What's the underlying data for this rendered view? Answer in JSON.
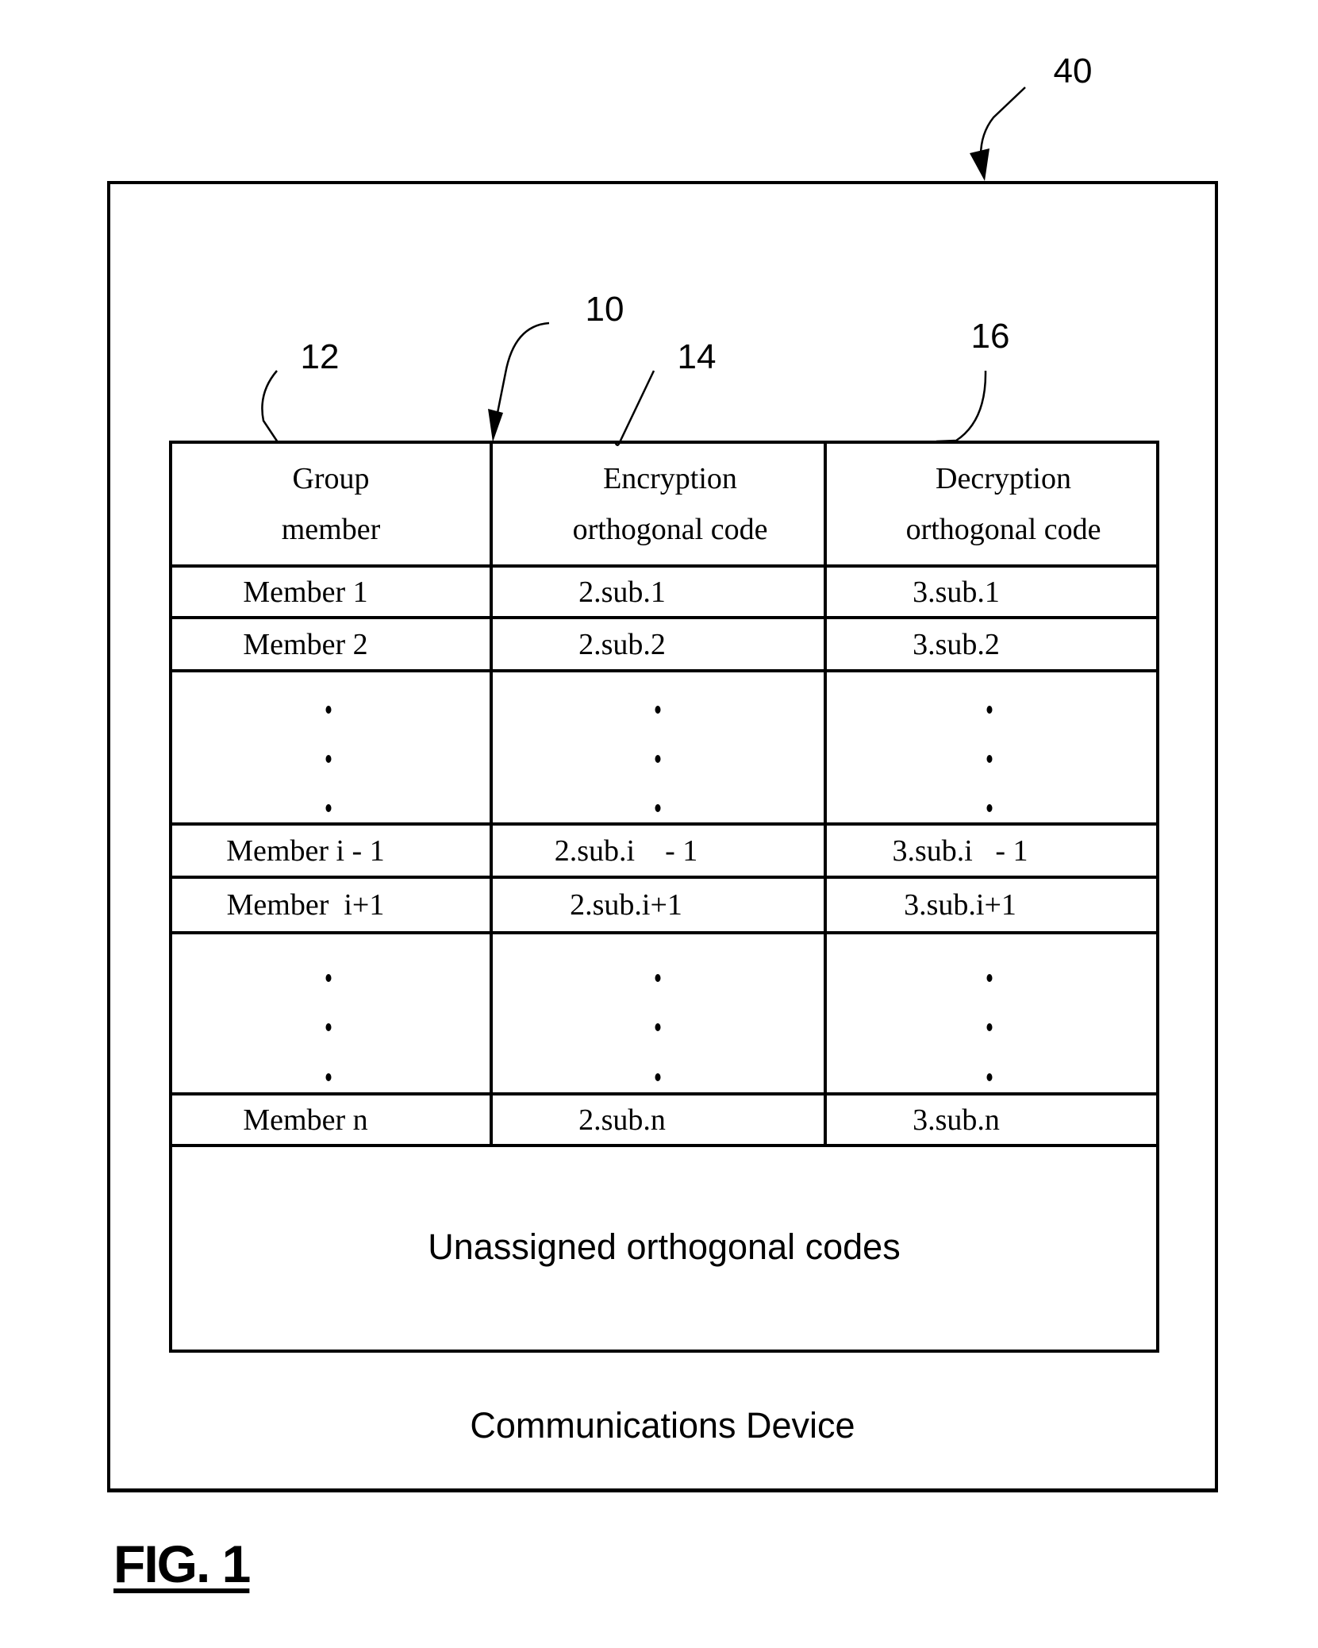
{
  "figure": {
    "label": "FIG. 1",
    "device_label": "Communications Device",
    "unassigned_label": "Unassigned orthogonal codes"
  },
  "reference_numerals": {
    "device": "40",
    "table": "10",
    "member_column": "12",
    "encryption_column": "14",
    "decryption_column": "16"
  },
  "table": {
    "headers": [
      {
        "line1": "Group",
        "line2": "member"
      },
      {
        "line1": "Encryption",
        "line2": "orthogonal code"
      },
      {
        "line1": "Decryption",
        "line2": "orthogonal code"
      }
    ],
    "rows": [
      {
        "member": "Member 1",
        "encryption": "2.sub.1",
        "decryption": "3.sub.1"
      },
      {
        "member": "Member 2",
        "encryption": "2.sub.2",
        "decryption": "3.sub.2"
      },
      {
        "ellipsis": true
      },
      {
        "member": "Member i - 1",
        "encryption": "2.sub.i    - 1",
        "decryption": "3.sub.i   - 1"
      },
      {
        "member": "Member  i+1",
        "encryption": "2.sub.i+1",
        "decryption": "3.sub.i+1"
      },
      {
        "ellipsis": true
      },
      {
        "member": "Member n",
        "encryption": "2.sub.n",
        "decryption": "3.sub.n"
      }
    ]
  }
}
